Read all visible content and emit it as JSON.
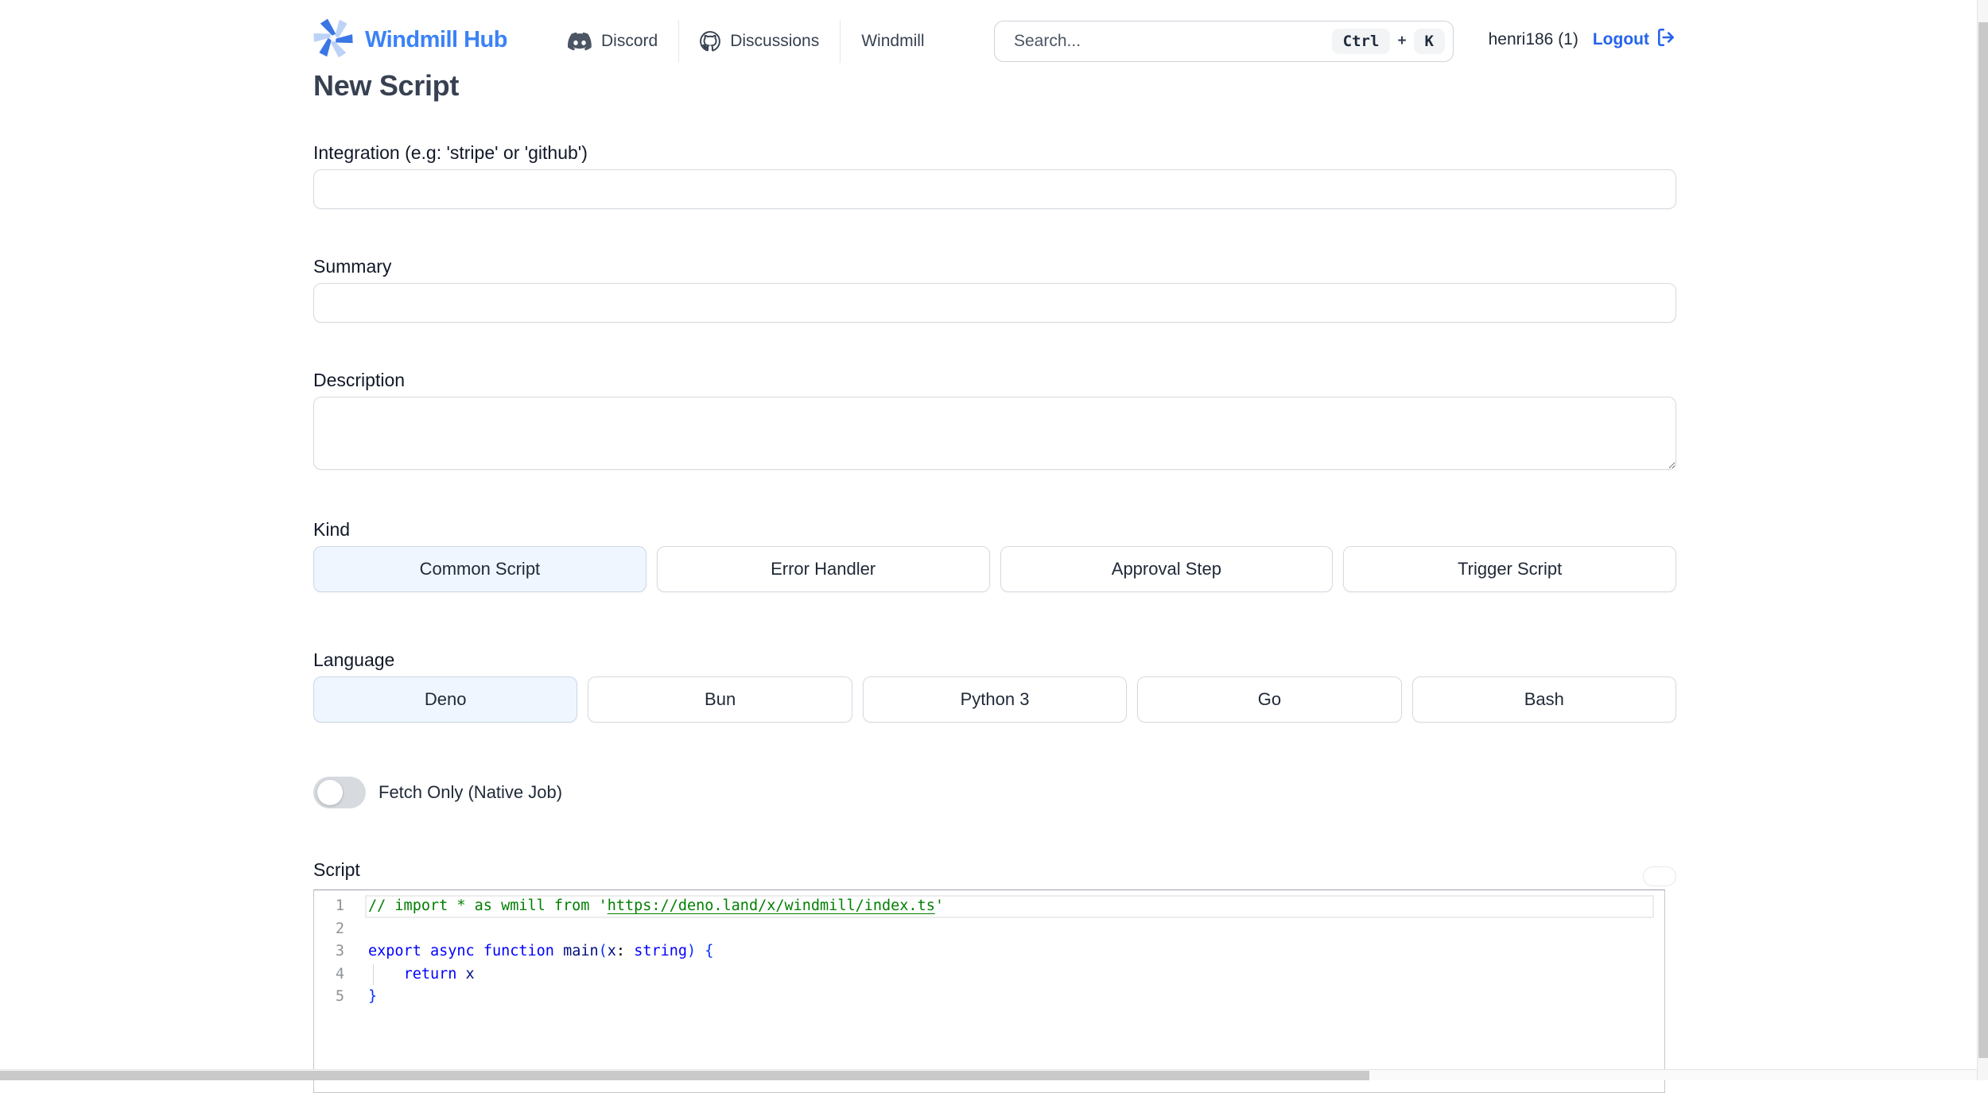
{
  "header": {
    "brand": "Windmill Hub",
    "nav": [
      {
        "label": "Discord",
        "icon": "discord-icon"
      },
      {
        "label": "Discussions",
        "icon": "github-icon"
      },
      {
        "label": "Windmill",
        "icon": null
      }
    ],
    "search": {
      "placeholder": "Search...",
      "value": "",
      "shortcut": {
        "ctrl": "Ctrl",
        "plus": "+",
        "k": "K"
      }
    },
    "user": {
      "name": "henri186 (1)",
      "logout_label": "Logout"
    }
  },
  "page": {
    "title": "New Script",
    "fields": {
      "integration": {
        "label": "Integration (e.g: 'stripe' or 'github')",
        "value": ""
      },
      "summary": {
        "label": "Summary",
        "value": ""
      },
      "description": {
        "label": "Description",
        "value": ""
      }
    },
    "kind": {
      "label": "Kind",
      "selected": "Common Script",
      "options": [
        "Common Script",
        "Error Handler",
        "Approval Step",
        "Trigger Script"
      ]
    },
    "language": {
      "label": "Language",
      "selected": "Deno",
      "options": [
        "Deno",
        "Bun",
        "Python 3",
        "Go",
        "Bash"
      ]
    },
    "fetch_only": {
      "label": "Fetch Only (Native Job)",
      "enabled": false
    },
    "script": {
      "label": "Script",
      "code_lines": [
        {
          "no": "1",
          "current": true,
          "indent_guide": false,
          "segments": [
            {
              "t": "// import * as wmill from '",
              "c": "comment"
            },
            {
              "t": "https://deno.land/x/windmill/index.ts",
              "c": "comment-link"
            },
            {
              "t": "'",
              "c": "comment"
            }
          ]
        },
        {
          "no": "2",
          "current": false,
          "indent_guide": false,
          "segments": []
        },
        {
          "no": "3",
          "current": false,
          "indent_guide": false,
          "segments": [
            {
              "t": "export",
              "c": "keyword"
            },
            {
              "t": " ",
              "c": "plain"
            },
            {
              "t": "async",
              "c": "keyword"
            },
            {
              "t": " ",
              "c": "plain"
            },
            {
              "t": "function",
              "c": "keyword"
            },
            {
              "t": " ",
              "c": "plain"
            },
            {
              "t": "main",
              "c": "ident"
            },
            {
              "t": "(",
              "c": "bracket"
            },
            {
              "t": "x",
              "c": "ident"
            },
            {
              "t": ": ",
              "c": "plain"
            },
            {
              "t": "string",
              "c": "keyword"
            },
            {
              "t": ")",
              "c": "bracket"
            },
            {
              "t": " ",
              "c": "plain"
            },
            {
              "t": "{",
              "c": "bracket"
            }
          ]
        },
        {
          "no": "4",
          "current": false,
          "indent_guide": true,
          "segments": [
            {
              "t": "    ",
              "c": "plain"
            },
            {
              "t": "return",
              "c": "keyword"
            },
            {
              "t": " ",
              "c": "plain"
            },
            {
              "t": "x",
              "c": "ident"
            }
          ]
        },
        {
          "no": "5",
          "current": false,
          "indent_guide": false,
          "segments": [
            {
              "t": "}",
              "c": "bracket"
            }
          ]
        }
      ]
    }
  },
  "colors": {
    "brand_blue": "#3b82f6",
    "link_blue": "#2563eb",
    "selected_bg": "#eff6ff",
    "code_comment": "#008000",
    "code_keyword": "#0000ff",
    "code_identifier": "#001080",
    "code_bracket": "#0431fa"
  }
}
